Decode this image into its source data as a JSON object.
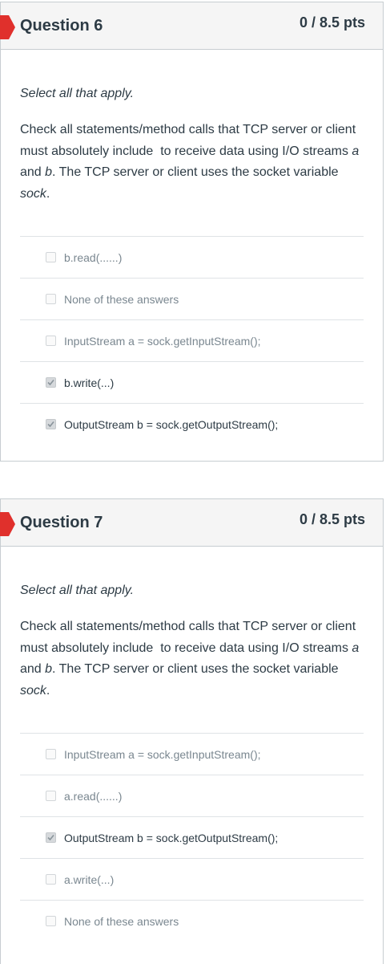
{
  "questions": [
    {
      "title": "Question 6",
      "points": "0 / 8.5 pts",
      "instruction": "Select all that apply.",
      "text": "Check all statements/method calls that TCP server or client must absolutely include  to receive data using I/O streams a and b. The TCP server or client uses the socket variable sock.",
      "answers": [
        {
          "label": "b.read(......)",
          "checked": false
        },
        {
          "label": "None of these answers",
          "checked": false
        },
        {
          "label": "InputStream a = sock.getInputStream();",
          "checked": false
        },
        {
          "label": "b.write(...)",
          "checked": true
        },
        {
          "label": "OutputStream b = sock.getOutputStream();",
          "checked": true
        }
      ]
    },
    {
      "title": "Question 7",
      "points": "0 / 8.5 pts",
      "instruction": "Select all that apply.",
      "text": "Check all statements/method calls that TCP server or client must absolutely include  to receive data using I/O streams a and b. The TCP server or client uses the socket variable sock.",
      "answers": [
        {
          "label": "InputStream a = sock.getInputStream();",
          "checked": false
        },
        {
          "label": "a.read(......)",
          "checked": false
        },
        {
          "label": "OutputStream b = sock.getOutputStream();",
          "checked": true
        },
        {
          "label": "a.write(...)",
          "checked": false
        },
        {
          "label": "None of these answers",
          "checked": false
        }
      ]
    }
  ],
  "colors": {
    "flag": "#e0302c",
    "header_bg": "#f5f5f5",
    "text": "#2d3b45",
    "muted": "#7a8790"
  }
}
